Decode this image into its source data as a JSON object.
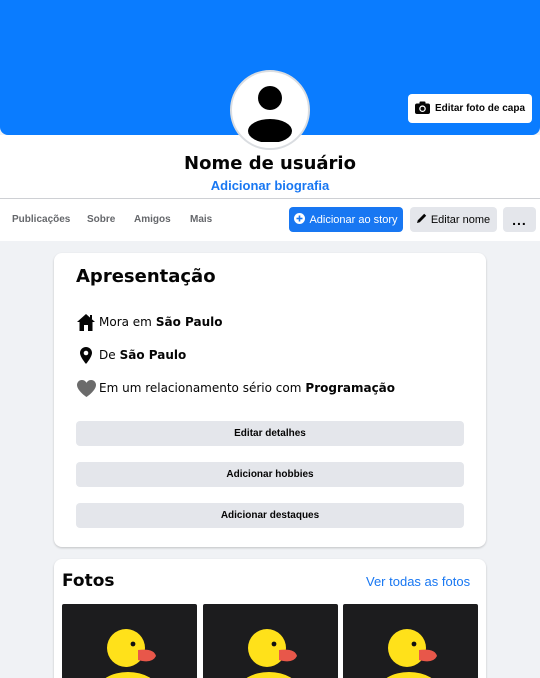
{
  "cover": {
    "edit_button_label": "Editar foto de capa",
    "color": "#0a7cff"
  },
  "profile": {
    "username": "Nome de usuário",
    "bio_link": "Adicionar biografia"
  },
  "tabs": [
    "Publicações",
    "Sobre",
    "Amigos",
    "Mais"
  ],
  "actions": {
    "add_story": "Adicionar ao story",
    "edit_name": "Editar nome",
    "more": "..."
  },
  "intro": {
    "title": "Apresentação",
    "lives_in_prefix": "Mora em",
    "lives_in_value": "São Paulo",
    "from_prefix": "De",
    "from_value": "São Paulo",
    "relationship_prefix": "Em um relacionamento sério com",
    "relationship_value": "Programação",
    "buttons": [
      "Editar detalhes",
      "Adicionar hobbies",
      "Adicionar destaques"
    ]
  },
  "photos": {
    "title": "Fotos",
    "see_all": "Ver todas as fotos",
    "items": [
      "rubber-duck-photo",
      "rubber-duck-photo",
      "rubber-duck-photo"
    ]
  }
}
